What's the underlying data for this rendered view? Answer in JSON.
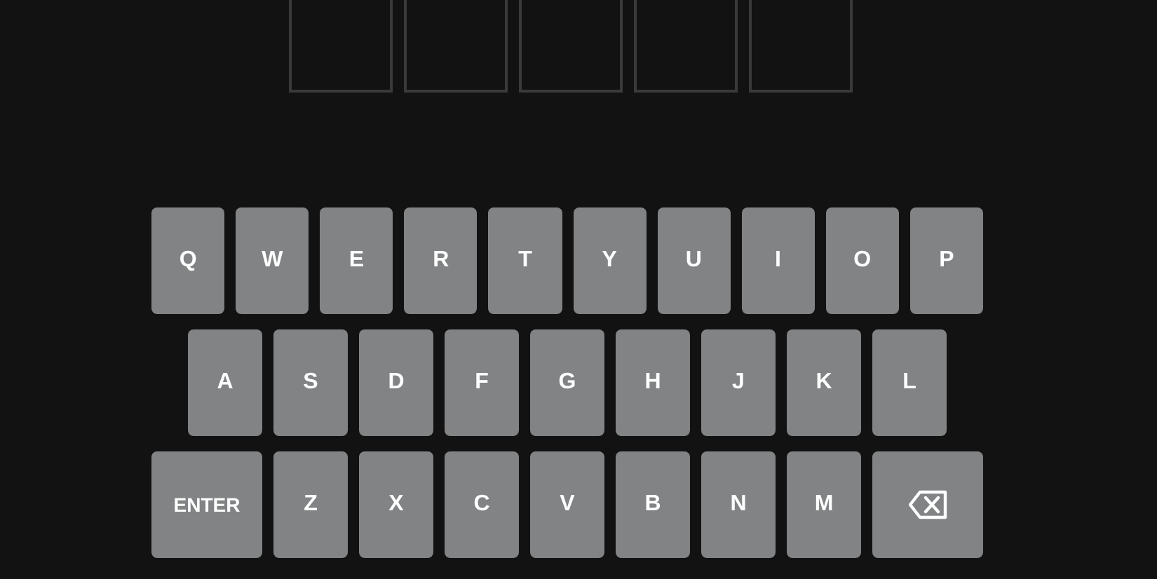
{
  "board": {
    "tiles": [
      {
        "kind": "empty"
      },
      {
        "kind": "empty"
      },
      {
        "kind": "empty"
      },
      {
        "kind": "empty"
      },
      {
        "kind": "empty"
      }
    ]
  },
  "keyboard": {
    "rows": [
      [
        {
          "kind": "letter",
          "label": "Q"
        },
        {
          "kind": "letter",
          "label": "W"
        },
        {
          "kind": "letter",
          "label": "E"
        },
        {
          "kind": "letter",
          "label": "R"
        },
        {
          "kind": "letter",
          "label": "T"
        },
        {
          "kind": "letter",
          "label": "Y"
        },
        {
          "kind": "letter",
          "label": "U"
        },
        {
          "kind": "letter",
          "label": "I"
        },
        {
          "kind": "letter",
          "label": "O"
        },
        {
          "kind": "letter",
          "label": "P"
        }
      ],
      [
        {
          "kind": "letter",
          "label": "A"
        },
        {
          "kind": "letter",
          "label": "S"
        },
        {
          "kind": "letter",
          "label": "D"
        },
        {
          "kind": "letter",
          "label": "F"
        },
        {
          "kind": "letter",
          "label": "G"
        },
        {
          "kind": "letter",
          "label": "H"
        },
        {
          "kind": "letter",
          "label": "J"
        },
        {
          "kind": "letter",
          "label": "K"
        },
        {
          "kind": "letter",
          "label": "L"
        }
      ],
      [
        {
          "kind": "enter",
          "label": "ENTER"
        },
        {
          "kind": "letter",
          "label": "Z"
        },
        {
          "kind": "letter",
          "label": "X"
        },
        {
          "kind": "letter",
          "label": "C"
        },
        {
          "kind": "letter",
          "label": "V"
        },
        {
          "kind": "letter",
          "label": "B"
        },
        {
          "kind": "letter",
          "label": "N"
        },
        {
          "kind": "letter",
          "label": "M"
        },
        {
          "kind": "backspace"
        }
      ]
    ]
  }
}
